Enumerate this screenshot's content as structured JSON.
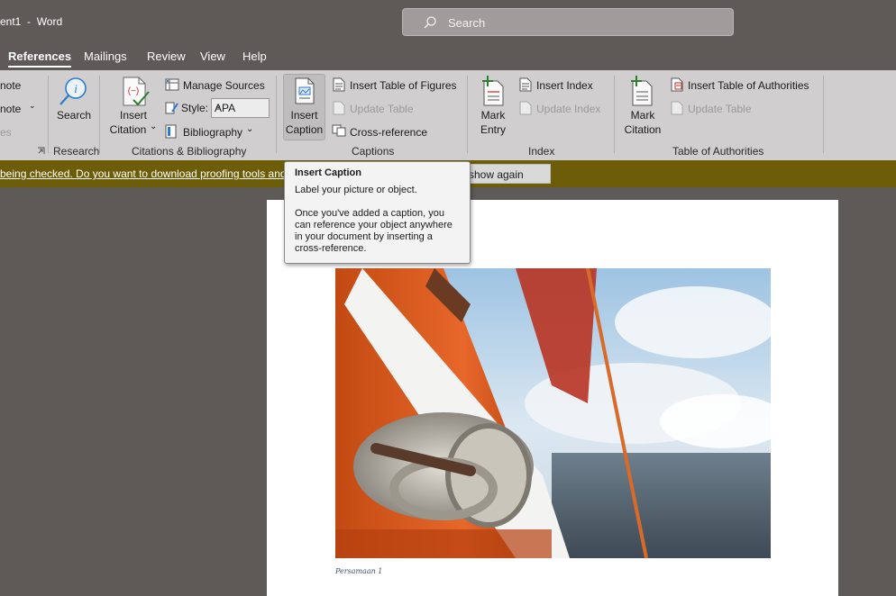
{
  "window": {
    "title": "ent1  -  Word"
  },
  "search": {
    "placeholder": "Search"
  },
  "tabs": [
    {
      "label": "References",
      "active": true
    },
    {
      "label": "Mailings"
    },
    {
      "label": "Review"
    },
    {
      "label": "View"
    },
    {
      "label": "Help"
    }
  ],
  "ribbon": {
    "footnotes": {
      "items": [
        "note",
        "note",
        "es"
      ]
    },
    "research": {
      "search_label": "Search",
      "group_label": "Research"
    },
    "citations": {
      "insert_citation_line1": "Insert",
      "insert_citation_line2": "Citation",
      "manage_sources": "Manage Sources",
      "style_label": "Style:",
      "style_value": "APA",
      "bibliography": "Bibliography",
      "group_label": "Citations & Bibliography"
    },
    "captions": {
      "insert_caption_line1": "Insert",
      "insert_caption_line2": "Caption",
      "insert_table_of_figures": "Insert Table of Figures",
      "update_table": "Update Table",
      "cross_reference": "Cross-reference",
      "group_label": "Captions"
    },
    "index": {
      "mark_entry_line1": "Mark",
      "mark_entry_line2": "Entry",
      "insert_index": "Insert Index",
      "update_index": "Update Index",
      "group_label": "Index"
    },
    "authorities": {
      "mark_citation_line1": "Mark",
      "mark_citation_line2": "Citation",
      "insert_table_of_authorities": "Insert Table of Authorities",
      "update_table": "Update Table",
      "group_label": "Table of Authorities"
    }
  },
  "notification": {
    "text": "being checked. Do you want to download proofing tools and",
    "button_label": "Don't show again"
  },
  "tooltip": {
    "title": "Insert Caption",
    "line1": "Label your picture or object.",
    "body": "Once you've added a caption, you can reference your object anywhere in your document by inserting a cross-reference."
  },
  "document": {
    "caption": "Persamaan 1"
  },
  "colors": {
    "title_bar": "#5e5a58",
    "ribbon": "#d0cece",
    "notification": "#6d5d08",
    "accent_green": "#2e7d32",
    "accent_red": "#c62828"
  }
}
